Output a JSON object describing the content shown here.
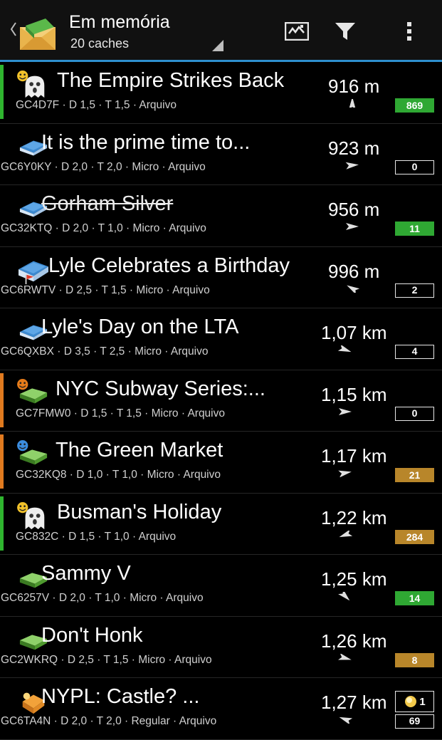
{
  "action_bar": {
    "title": "Em memória",
    "subtitle": "20 caches",
    "actions": [
      "map-icon",
      "filter-icon",
      "overflow-menu-icon"
    ]
  },
  "colors": {
    "accent_line": "#2e8fcf",
    "found_green": "#2fa833",
    "favorite_brown": "#b8862a",
    "stripe_green": "#2fb52f",
    "stripe_orange": "#e07a1f"
  },
  "caches": [
    {
      "name": "The Empire Strikes Back",
      "info": "GC4D7F · D 1,5 · T 1,5 · Arquivo",
      "distance": "916 m",
      "badge": "869",
      "badge_style": "green",
      "icon": "ghost-virtual-cache-icon",
      "overlay": "happy-smiley-icon",
      "stripe": "green",
      "direction_deg": -90
    },
    {
      "name": "It is the prime time to...",
      "info": "GC6Y0KY · D 2,0 · T 2,0 · Micro · Arquivo",
      "distance": "923 m",
      "badge": "0",
      "badge_style": "outline",
      "icon": "multi-cache-icon",
      "overlay": "",
      "stripe": "",
      "direction_deg": -5
    },
    {
      "name": "Gorham Silver",
      "info": "GC32KTQ · D 2,0 · T 1,0 · Micro · Arquivo",
      "distance": "956 m",
      "badge": "11",
      "badge_style": "green",
      "icon": "multi-cache-icon",
      "overlay": "",
      "stripe": "",
      "direction_deg": 0,
      "strikethrough": true
    },
    {
      "name": "Lyle Celebrates a Birthday",
      "info": "GC6RWTV · D 2,5 · T 1,5 · Micro · Arquivo",
      "distance": "996 m",
      "badge": "2",
      "badge_style": "outline",
      "icon": "multi-cache-flag-icon",
      "overlay": "",
      "stripe": "",
      "direction_deg": -150
    },
    {
      "name": "Lyle's Day on the LTA",
      "info": "GC6QXBX · D 3,5 · T 2,5 · Micro · Arquivo",
      "distance": "1,07 km",
      "badge": "4",
      "badge_style": "outline",
      "icon": "multi-cache-icon",
      "overlay": "",
      "stripe": "",
      "direction_deg": 20
    },
    {
      "name": "NYC Subway Series:...",
      "info": "GC7FMW0 · D 1,5 · T 1,5 · Micro · Arquivo",
      "distance": "1,15 km",
      "badge": "0",
      "badge_style": "outline",
      "icon": "traditional-cache-icon",
      "overlay": "smiley-orange-icon",
      "stripe": "orange",
      "direction_deg": 0
    },
    {
      "name": "The Green Market",
      "info": "GC32KQ8 · D 1,0 · T 1,0 · Micro · Arquivo",
      "distance": "1,17 km",
      "badge": "21",
      "badge_style": "brown",
      "icon": "traditional-cache-icon",
      "overlay": "smiley-blue-icon",
      "stripe": "orange",
      "direction_deg": -10
    },
    {
      "name": "Busman's Holiday",
      "info": "GC832C · D 1,5 · T 1,0 · Arquivo",
      "distance": "1,22 km",
      "badge": "284",
      "badge_style": "brown",
      "icon": "ghost-virtual-cache-icon",
      "overlay": "happy-smiley-icon",
      "stripe": "green",
      "direction_deg": 160
    },
    {
      "name": "Sammy V",
      "info": "GC6257V · D 2,0 · T 1,0 · Micro · Arquivo",
      "distance": "1,25 km",
      "badge": "14",
      "badge_style": "green",
      "icon": "traditional-cache-icon",
      "overlay": "",
      "stripe": "",
      "direction_deg": 45
    },
    {
      "name": "Don't Honk",
      "info": "GC2WKRQ · D 2,5 · T 1,5 · Micro · Arquivo",
      "distance": "1,26 km",
      "badge": "8",
      "badge_style": "brown",
      "icon": "traditional-cache-icon",
      "overlay": "",
      "stripe": "",
      "direction_deg": 15
    },
    {
      "name": "NYPL: Castle? ...",
      "info": "GC6TA4N · D 2,0 · T 2,0 · Regular · Arquivo",
      "distance": "1,27 km",
      "badge": "69",
      "badge_style": "outline",
      "icon": "puzzle-mystery-cache-icon",
      "overlay": "",
      "stripe": "",
      "direction_deg": -160,
      "top_badge": "1"
    }
  ]
}
